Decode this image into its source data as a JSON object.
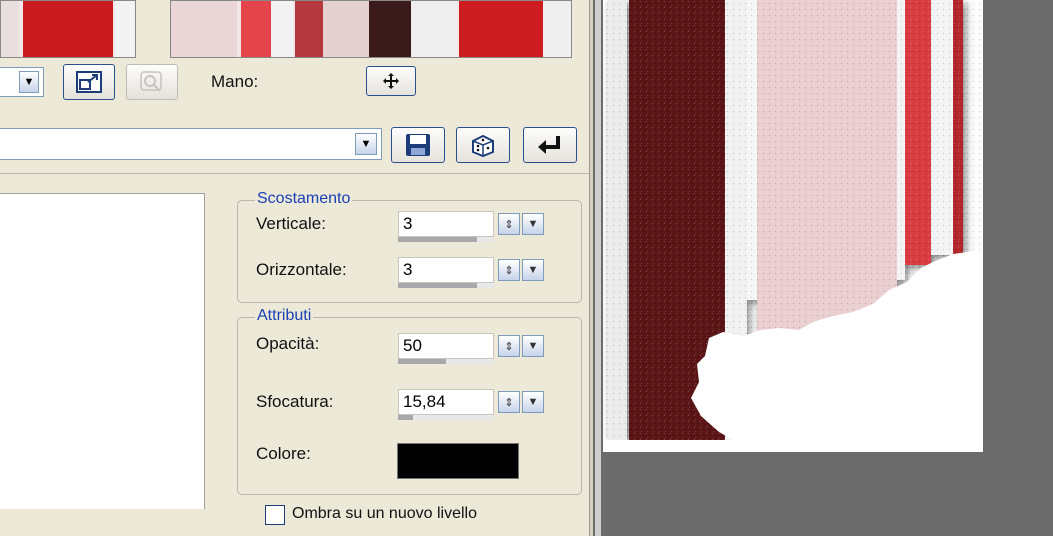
{
  "toolbar": {
    "mano_label": "Mano:"
  },
  "preset": {
    "value": ""
  },
  "offset": {
    "legend": "Scostamento",
    "vertical_label": "Verticale:",
    "vertical_value": "3",
    "vertical_slider_fraction": 0.82,
    "horizontal_label": "Orizzontale:",
    "horizontal_value": "3",
    "horizontal_slider_fraction": 0.82
  },
  "attributes": {
    "legend": "Attributi",
    "opacity_label": "Opacità:",
    "opacity_value": "50",
    "opacity_slider_fraction": 0.5,
    "blur_label": "Sfocatura:",
    "blur_value": "15,84",
    "blur_slider_fraction": 0.16,
    "color_label": "Colore:",
    "color_value": "#000000"
  },
  "new_layer_checkbox": {
    "label": "Ombra su un nuovo livello",
    "checked": false
  },
  "icons": {
    "window": "window-resize-icon",
    "disabled": "magnify-icon",
    "mano": "move-cross-icon",
    "save": "floppy-save-icon",
    "random": "dice-icon",
    "reset": "undo-arrow-icon"
  },
  "colors": {
    "dialog_bg": "#ECE9D8",
    "accent_blue": "#1a3fb5",
    "stripe_dark": "#5a1518",
    "stripe_red": "#d83a40",
    "stripe_pink": "#e9cfd0",
    "workspace_gray": "#6b6b6b"
  }
}
